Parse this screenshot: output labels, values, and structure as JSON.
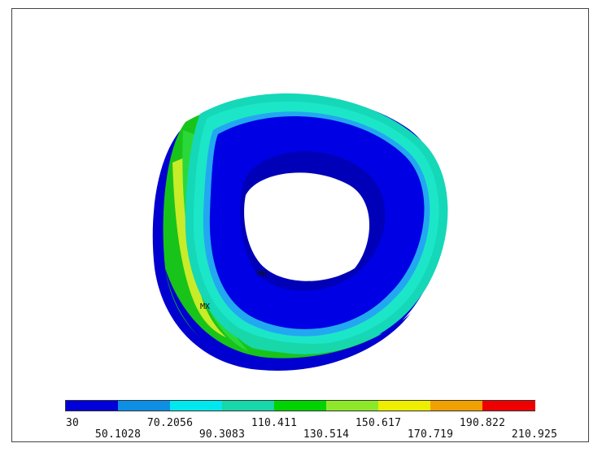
{
  "figure": {
    "markers": {
      "min": "MN",
      "max": "MX"
    },
    "legend": {
      "colors": [
        "#0000d8",
        "#0d8fe6",
        "#00e8ee",
        "#18d7a8",
        "#00d400",
        "#8ee82a",
        "#eeee00",
        "#f0a000",
        "#ee0000"
      ],
      "ticks": [
        "30",
        "50.1028",
        "70.2056",
        "90.3083",
        "110.411",
        "130.514",
        "150.617",
        "170.719",
        "190.822",
        "210.925"
      ]
    }
  }
}
